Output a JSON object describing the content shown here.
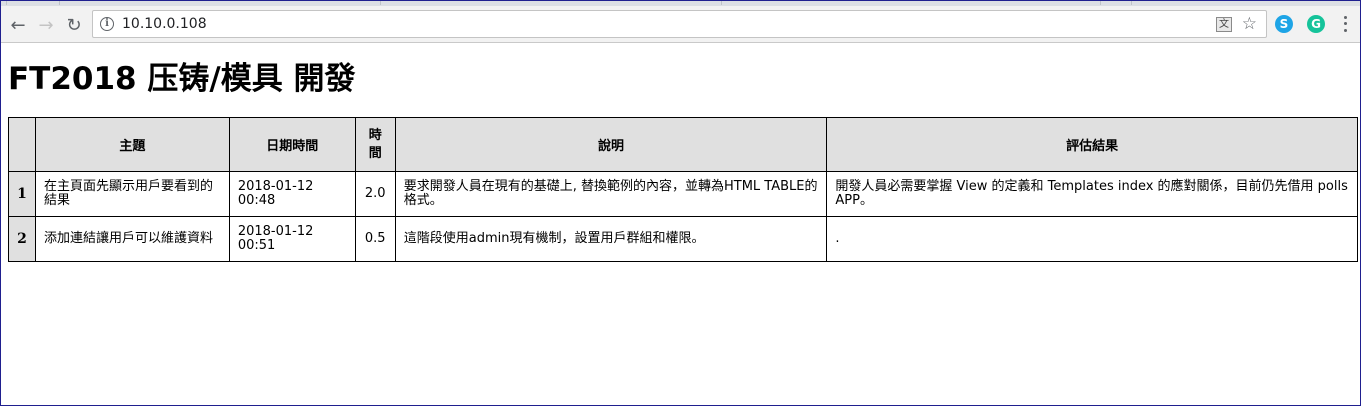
{
  "browser": {
    "url": "10.10.0.108",
    "back_icon": "←",
    "forward_icon": "→",
    "reload_icon": "↻",
    "info_icon": "i",
    "translate_icon": "文",
    "star_icon": "☆",
    "extensions": [
      {
        "name": "skype-extension-icon",
        "glyph": "S",
        "color": "#1ea4e6"
      },
      {
        "name": "grammarly-extension-icon",
        "glyph": "G",
        "color": "#15c39a"
      }
    ]
  },
  "page": {
    "title": "FT2018 压铸/模具 開發",
    "table": {
      "headers": [
        "",
        "主題",
        "日期時間",
        "時間",
        "說明",
        "評估結果"
      ],
      "rows": [
        {
          "index": "1",
          "subject": "在主頁面先顯示用戶要看到的結果",
          "datetime": "2018-01-12 00:48",
          "hours": "2.0",
          "description": "要求開發人員在現有的基礎上, 替換範例的內容，並轉為HTML TABLE的格式。",
          "result": "開發人員必需要掌握 View 的定義和 Templates index 的應對關係，目前仍先借用 polls APP。"
        },
        {
          "index": "2",
          "subject": "添加連結讓用戶可以維護資料",
          "datetime": "2018-01-12 00:51",
          "hours": "0.5",
          "description": "這階段使用admin現有機制，設置用戶群組和權限。",
          "result": "."
        }
      ]
    }
  }
}
